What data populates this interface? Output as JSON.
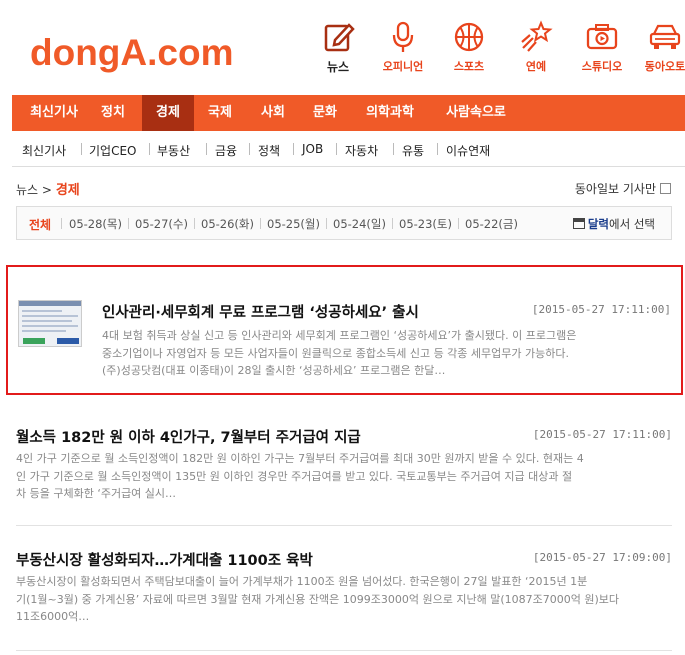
{
  "brand": {
    "logo_text": "dongA.com",
    "accent": "#f05a28",
    "dark_accent": "#a82f12"
  },
  "categories": [
    {
      "label": "뉴스",
      "icon": "pencil-note-icon",
      "active": true
    },
    {
      "label": "오피니언",
      "icon": "microphone-icon",
      "active": false
    },
    {
      "label": "스포츠",
      "icon": "basketball-icon",
      "active": false
    },
    {
      "label": "연예",
      "icon": "shooting-star-icon",
      "active": false
    },
    {
      "label": "스튜디오",
      "icon": "camera-icon",
      "active": false
    },
    {
      "label": "동아오토",
      "icon": "car-icon",
      "active": false
    }
  ],
  "main_nav": [
    "최신기사",
    "정치",
    "경제",
    "국제",
    "사회",
    "문화",
    "의학과학",
    "사람속으로"
  ],
  "main_nav_active": "경제",
  "sub_nav": [
    "최신기사",
    "기업CEO",
    "부동산",
    "금융",
    "정책",
    "JOB",
    "자동차",
    "유통",
    "이슈연재"
  ],
  "breadcrumb": {
    "root": "뉴스",
    "sep": ">",
    "current": "경제"
  },
  "reporter_filter": {
    "label": "동아일보 기사만"
  },
  "date_bar": {
    "all": "전체",
    "dates": [
      "05-28(목)",
      "05-27(수)",
      "05-26(화)",
      "05-25(월)",
      "05-24(일)",
      "05-23(토)",
      "05-22(금)"
    ],
    "calendar_link": "달력",
    "calendar_suffix": "에서 선택"
  },
  "articles": [
    {
      "title": "인사관리·세무회계 무료 프로그램 ‘성공하세요’ 출시",
      "date": "[2015-05-27 17:11:00]",
      "lines": [
        "4대 보험 취득과 상실 신고 등 인사관리와 세무회계 프로그램인 ‘성공하세요’가 출시됐다. 이 프로그램은",
        "중소기업이나 자영업자 등 모든 사업자들이 원클릭으로 종합소득세 신고 등 각종 세무업무가 가능하다.",
        "(주)성공닷컴(대표 이종태)이 28일 출시한 ‘성공하세요’ 프로그램은 한달…"
      ],
      "has_thumbnail": true
    },
    {
      "title": "월소득 182만 원 이하 4인가구, 7월부터 주거급여 지급",
      "date": "[2015-05-27 17:11:00]",
      "lines": [
        "4인 가구 기준으로 월 소득인정액이 182만 원 이하인 가구는 7월부터 주거급여를 최대 30만 원까지 받을 수 있다. 현재는 4",
        "인 가구 기준으로 월 소득인정액이 135만 원 이하인 경우만 주거급여를 받고 있다. 국토교통부는 주거급여 지급 대상과 절",
        "차 등을 구체화한 ‘주거급여 실시…"
      ],
      "has_thumbnail": false
    },
    {
      "title": "부동산시장 활성화되자…가계대출 1100조 육박",
      "date": "[2015-05-27 17:09:00]",
      "lines": [
        "부동산시장이 활성화되면서 주택담보대출이 늘어 가계부채가 1100조 원을 넘어섰다. 한국은행이 27일 발표한 ‘2015년 1분",
        "기(1월~3월) 중 가계신용’ 자료에 따르면 3월말 현재 가계신용 잔액은 1099조3000억 원으로 지난해 말(1087조7000억 원)보다",
        " 11조6000억…"
      ],
      "has_thumbnail": false
    }
  ]
}
